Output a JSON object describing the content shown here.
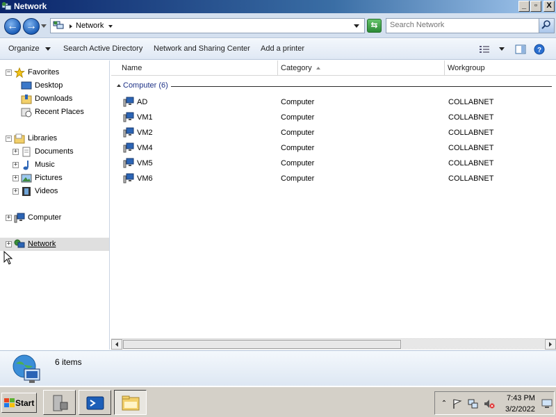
{
  "window": {
    "title": "Network"
  },
  "caption_buttons": {
    "minimize": "_",
    "maximize": "▫",
    "close": "X"
  },
  "address": {
    "breadcrumb": "Network"
  },
  "search": {
    "placeholder": "Search Network"
  },
  "toolbar": {
    "organize": "Organize",
    "search_ad": "Search Active Directory",
    "network_sharing": "Network and Sharing Center",
    "add_printer": "Add a printer"
  },
  "nav": {
    "favorites": {
      "label": "Favorites",
      "items": [
        "Desktop",
        "Downloads",
        "Recent Places"
      ]
    },
    "libraries": {
      "label": "Libraries",
      "items": [
        "Documents",
        "Music",
        "Pictures",
        "Videos"
      ]
    },
    "computer": "Computer",
    "network": "Network",
    "expander_plus": "+",
    "expander_minus": "−"
  },
  "columns": {
    "name": "Name",
    "category": "Category",
    "workgroup": "Workgroup"
  },
  "group": {
    "label": "Computer (6)"
  },
  "rows": [
    {
      "name": "AD",
      "category": "Computer",
      "workgroup": "COLLABNET"
    },
    {
      "name": "VM1",
      "category": "Computer",
      "workgroup": "COLLABNET"
    },
    {
      "name": "VM2",
      "category": "Computer",
      "workgroup": "COLLABNET"
    },
    {
      "name": "VM4",
      "category": "Computer",
      "workgroup": "COLLABNET"
    },
    {
      "name": "VM5",
      "category": "Computer",
      "workgroup": "COLLABNET"
    },
    {
      "name": "VM6",
      "category": "Computer",
      "workgroup": "COLLABNET"
    }
  ],
  "details": {
    "item_count": "6 items"
  },
  "taskbar": {
    "start": "Start",
    "time": "7:43 PM",
    "date": "3/2/2022"
  },
  "colors": {
    "titlebar": "#0a246a",
    "selection": "#dfdfdf",
    "group_header": "#1e3287"
  }
}
